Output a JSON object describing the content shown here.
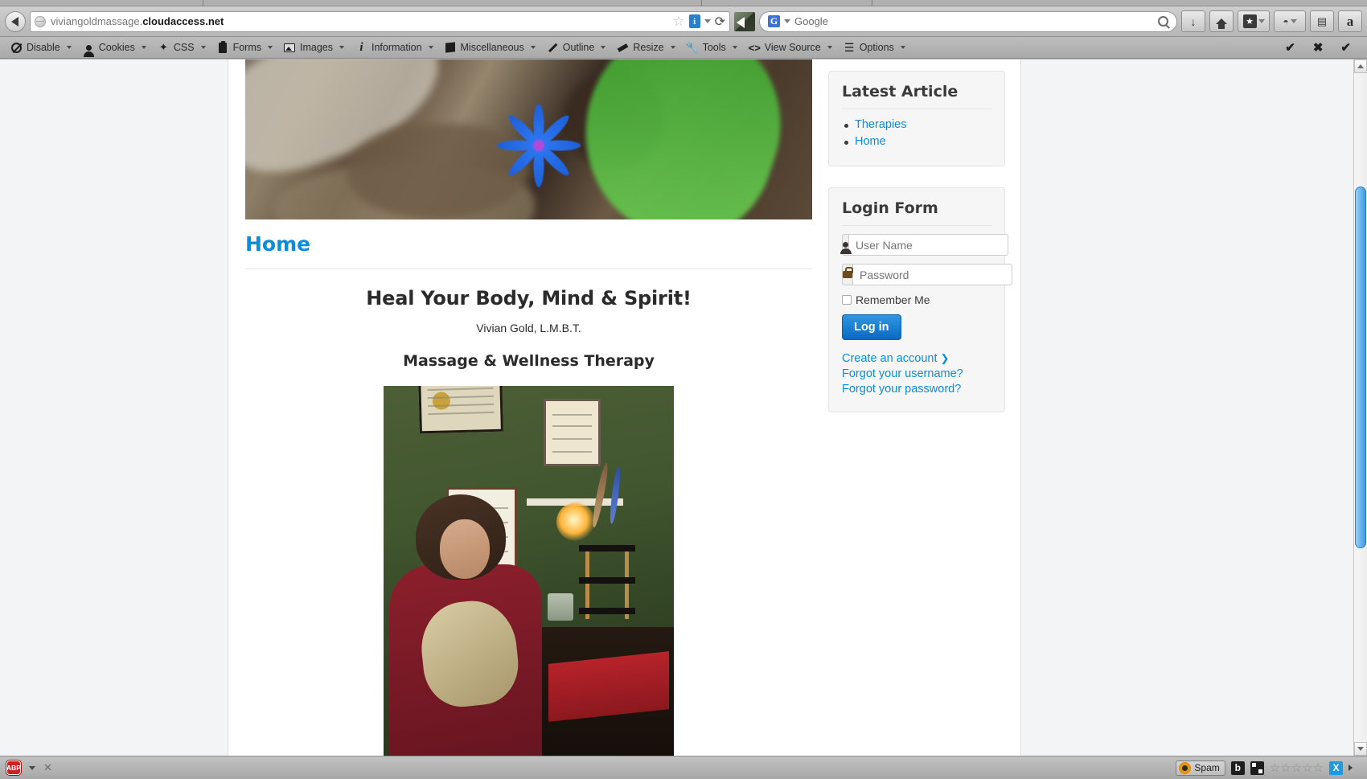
{
  "browser": {
    "back_button": "back-arrow",
    "url_prefix": "viviangoldmassage.",
    "url_domain": "cloudaccess.net",
    "identity_badge": "i",
    "reload_glyph": "⟳",
    "search_engine": "Google",
    "search_engine_badge": "G",
    "buttons": {
      "download": "↓",
      "home": "home-icon",
      "bookmarks": "★",
      "pocket": "pocket-icon",
      "amazon": "a"
    }
  },
  "devbar": {
    "items": [
      {
        "label": "Disable",
        "icon": "no-entry-icon"
      },
      {
        "label": "Cookies",
        "icon": "person-icon"
      },
      {
        "label": "CSS",
        "icon": "wand-icon"
      },
      {
        "label": "Forms",
        "icon": "clipboard-icon"
      },
      {
        "label": "Images",
        "icon": "picture-icon"
      },
      {
        "label": "Information",
        "icon": "info-icon"
      },
      {
        "label": "Miscellaneous",
        "icon": "box-icon"
      },
      {
        "label": "Outline",
        "icon": "pencil-icon"
      },
      {
        "label": "Resize",
        "icon": "ruler-icon"
      },
      {
        "label": "Tools",
        "icon": "wrench-icon"
      },
      {
        "label": "View Source",
        "icon": "code-icon"
      },
      {
        "label": "Options",
        "icon": "sliders-icon"
      }
    ],
    "right_icons": [
      "check-icon",
      "close-icon",
      "check-icon"
    ],
    "check_glyph": "✔",
    "close_glyph": "✖"
  },
  "page": {
    "breadcrumb_title": "Home",
    "heading": "Heal Your Body, Mind & Spirit!",
    "byline": "Vivian Gold, L.M.B.T.",
    "subheading": "Massage & Wellness Therapy",
    "banner_alt": "blue-flower-banner-image",
    "photo_alt": "therapist-portrait-photo"
  },
  "sidebar": {
    "latest_article": {
      "title": "Latest Article",
      "links": [
        "Therapies",
        "Home"
      ]
    },
    "login_form": {
      "title": "Login Form",
      "username_placeholder": "User Name",
      "username_value": "",
      "password_placeholder": "Password",
      "password_value": "",
      "remember_label": "Remember Me",
      "remember_checked": false,
      "submit_label": "Log in",
      "links": [
        {
          "label": "Create an account",
          "arrow": "❯"
        },
        {
          "label": "Forgot your username?",
          "arrow": ""
        },
        {
          "label": "Forgot your password?",
          "arrow": ""
        }
      ]
    }
  },
  "statusbar": {
    "adblock_label": "ABP",
    "close_glyph": "✕",
    "spam_label": "Spam",
    "b_label": "b",
    "stars": "☆☆☆☆☆",
    "x_label": "X"
  },
  "colors": {
    "link": "#0b8ddb",
    "accent_button": "#0a69c4",
    "chrome": "#b4b4b4",
    "module_bg": "#f6f6f6",
    "page_bg": "#f2f4f6"
  },
  "scroll": {
    "vertical_thumb_top_pct": 17,
    "vertical_thumb_height_pct": 54
  }
}
